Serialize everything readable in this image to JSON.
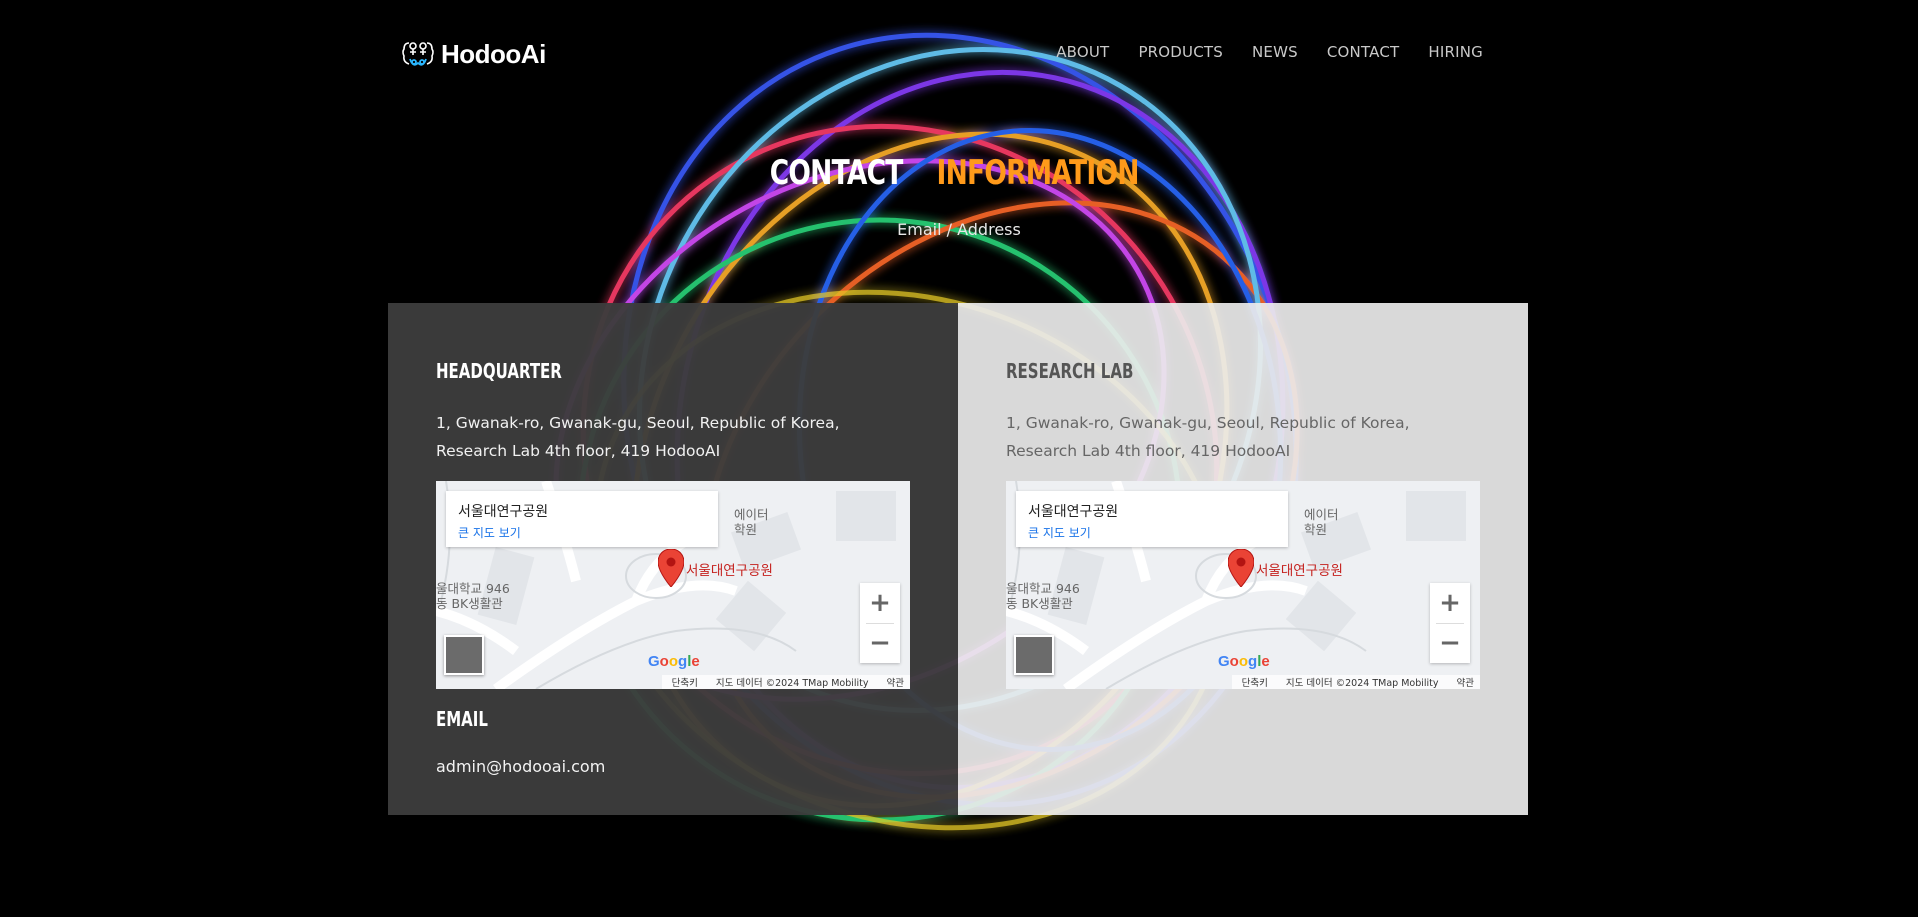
{
  "brand": {
    "name": "HodooAi"
  },
  "nav": {
    "items": [
      "ABOUT",
      "PRODUCTS",
      "NEWS",
      "CONTACT",
      "HIRING"
    ]
  },
  "heading": {
    "part1": "CONTACT",
    "part2": "INFORMATION",
    "subtitle": "Email / Address"
  },
  "panels": [
    {
      "title": "HEADQUARTER",
      "address": "1, Gwanak-ro, Gwanak-gu, Seoul, Republic of Korea, Research Lab 4th floor, 419 HodooAI",
      "email_title": "EMAIL",
      "email": "admin@hodooai.com"
    },
    {
      "title": "RESEARCH LAB",
      "address": "1, Gwanak-ro, Gwanak-gu, Seoul, Republic of Korea, Research Lab 4th floor, 419 HodooAI"
    }
  ],
  "map": {
    "place": "서울대연구공원",
    "view_larger": "큰 지도 보기",
    "pin_label": "서울대연구공원",
    "poi_top": "에이터",
    "poi_top2": "학원",
    "poi_left1": "울대학교 946",
    "poi_left2": "동 BK생활관",
    "zoom_in": "+",
    "zoom_out": "−",
    "google": "Google",
    "attrib_shortcuts": "단축키",
    "attrib_data": "지도 데이터 ©2024 TMap Mobility",
    "attrib_terms": "약관"
  },
  "colors": {
    "accent": "#ff9a1a",
    "dark_panel": "#3c3c3c",
    "light_panel": "#ececec"
  }
}
